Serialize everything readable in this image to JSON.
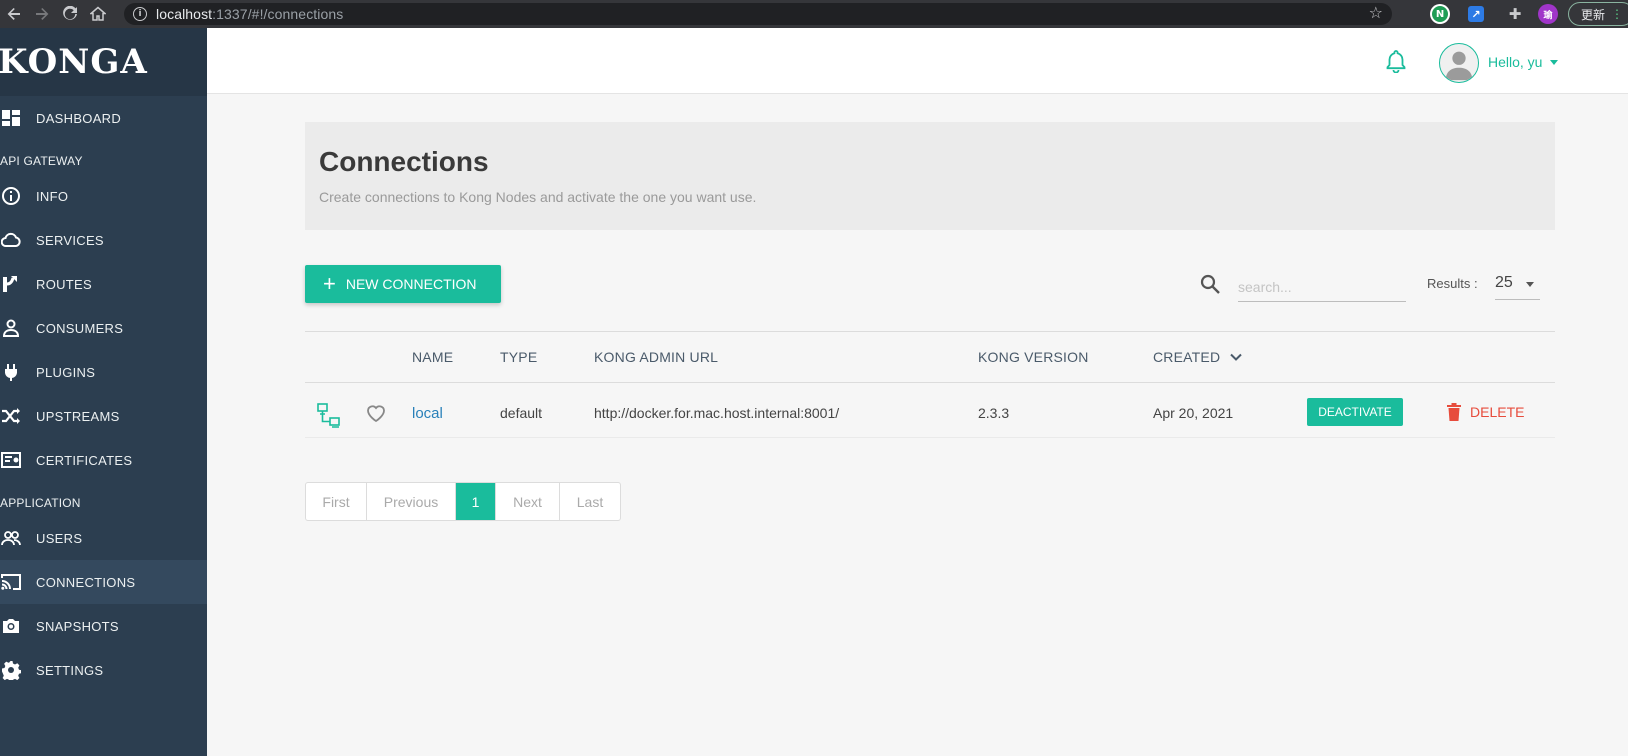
{
  "browser": {
    "url_host": "localhost",
    "url_rest": ":1337/#!/connections",
    "update_label": "更新",
    "ext_user_initial": "瑜"
  },
  "sidebar": {
    "logo": "KONGA",
    "items": [
      {
        "label": "DASHBOARD",
        "icon": "dashboard-icon"
      },
      {
        "section": "API GATEWAY"
      },
      {
        "label": "INFO",
        "icon": "info-icon"
      },
      {
        "label": "SERVICES",
        "icon": "cloud-icon"
      },
      {
        "label": "ROUTES",
        "icon": "routes-icon"
      },
      {
        "label": "CONSUMERS",
        "icon": "person-icon"
      },
      {
        "label": "PLUGINS",
        "icon": "plug-icon"
      },
      {
        "label": "UPSTREAMS",
        "icon": "shuffle-icon"
      },
      {
        "label": "CERTIFICATES",
        "icon": "certificate-icon"
      },
      {
        "section": "APPLICATION"
      },
      {
        "label": "USERS",
        "icon": "users-icon"
      },
      {
        "label": "CONNECTIONS",
        "icon": "cast-icon",
        "active": true
      },
      {
        "label": "SNAPSHOTS",
        "icon": "camera-icon"
      },
      {
        "label": "SETTINGS",
        "icon": "gear-icon"
      }
    ]
  },
  "topbar": {
    "greeting": "Hello, yu"
  },
  "header": {
    "title": "Connections",
    "subtitle": "Create connections to Kong Nodes and activate the one you want use."
  },
  "toolbar": {
    "new_label": "NEW CONNECTION",
    "search_placeholder": "search...",
    "results_label": "Results :",
    "results_value": "25"
  },
  "table": {
    "headers": [
      "NAME",
      "TYPE",
      "KONG ADMIN URL",
      "KONG VERSION",
      "CREATED"
    ],
    "rows": [
      {
        "name": "local",
        "type": "default",
        "url": "http://docker.for.mac.host.internal:8001/",
        "version": "2.3.3",
        "created": "Apr 20, 2021",
        "deactivate_label": "DEACTIVATE",
        "delete_label": "DELETE"
      }
    ]
  },
  "pagination": [
    "First",
    "Previous",
    "1",
    "Next",
    "Last"
  ],
  "colors": {
    "accent": "#1abc9c",
    "sidebar": "#2c3e50",
    "danger": "#e74c3c",
    "link": "#2980b9"
  }
}
